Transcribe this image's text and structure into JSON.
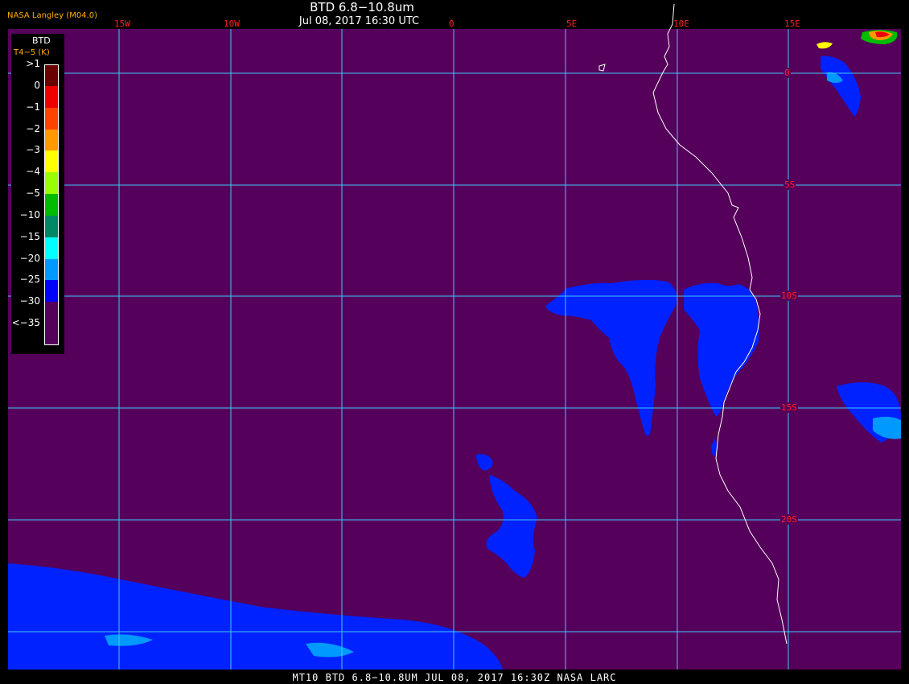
{
  "header": {
    "title": "BTD 6.8−10.8um",
    "subtitle": "Jul 08, 2017 16:30 UTC",
    "brand": "NASA Langley (M04.0)"
  },
  "footer": {
    "text": "MT10  BTD 6.8−10.8UM   JUL 08, 2017 16:30Z   NASA LARC"
  },
  "grid": {
    "longitude_labels": [
      "15W",
      "10W",
      "0",
      "5E",
      "10E",
      "15E"
    ],
    "latitude_labels": [
      "0",
      "5S",
      "10S",
      "15S",
      "20S"
    ],
    "line_color": "#40c8ff",
    "label_color": "#ff2020"
  },
  "legend": {
    "title": "BTD",
    "unit": "T4−5 (K)",
    "classes": [
      {
        "label": ">1",
        "color": "#6a0000"
      },
      {
        "label": "0",
        "color": "#ee0000"
      },
      {
        "label": "−1",
        "color": "#ff4400"
      },
      {
        "label": "−2",
        "color": "#ff9900"
      },
      {
        "label": "−3",
        "color": "#ffff00"
      },
      {
        "label": "−4",
        "color": "#99ff00"
      },
      {
        "label": "−5",
        "color": "#00bb00"
      },
      {
        "label": "−10",
        "color": "#008866"
      },
      {
        "label": "−15",
        "color": "#00ffff"
      },
      {
        "label": "−20",
        "color": "#0099ff"
      },
      {
        "label": "−25",
        "color": "#0000ff"
      },
      {
        "label": "−30",
        "color": "#55005a"
      },
      {
        "label": "<−35",
        "color": "#55005a"
      }
    ]
  },
  "colors": {
    "background": "#55005a",
    "cloud": "#0022ff",
    "coast": "#ffffff"
  }
}
